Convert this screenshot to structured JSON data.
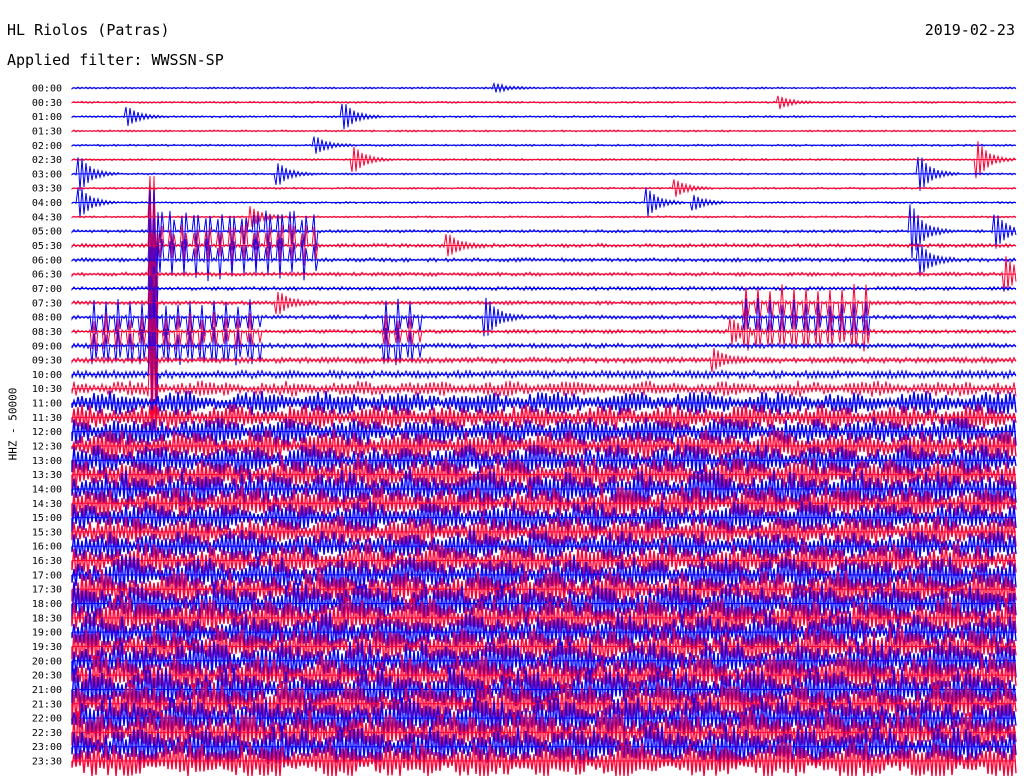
{
  "header": {
    "station": "HL Riolos (Patras)",
    "date": "2019-02-23",
    "filter": "Applied filter: WWSSN-SP"
  },
  "channel_label": "HHZ - 50000",
  "colors": {
    "trace_a": "#0000ff",
    "trace_b": "#ff0033",
    "baseline": "#0000ff"
  },
  "chart_data": {
    "type": "line",
    "title": "HL Riolos (Patras)",
    "subtitle": "Applied filter: WWSSN-SP",
    "ylabel": "HHZ - 50000",
    "xlabel": "",
    "row_labels": [
      "00:00",
      "00:30",
      "01:00",
      "01:30",
      "02:00",
      "02:30",
      "03:00",
      "03:30",
      "04:00",
      "04:30",
      "05:00",
      "05:30",
      "06:00",
      "06:30",
      "07:00",
      "07:30",
      "08:00",
      "08:30",
      "09:00",
      "09:30",
      "10:00",
      "10:30",
      "11:00",
      "11:30",
      "12:00",
      "12:30",
      "13:00",
      "13:30",
      "14:00",
      "14:30",
      "15:00",
      "15:30",
      "16:00",
      "16:30",
      "17:00",
      "17:30",
      "18:00",
      "18:30",
      "19:00",
      "19:30",
      "20:00",
      "20:30",
      "21:00",
      "21:30",
      "22:00",
      "22:30",
      "23:00",
      "23:30"
    ],
    "row_colors": [
      "blue",
      "red"
    ],
    "noise_level": [
      1,
      1,
      1,
      1,
      1,
      1,
      1,
      1,
      1,
      1,
      1.5,
      2,
      2,
      2,
      2,
      2,
      2,
      2,
      2.5,
      3,
      4,
      6,
      9,
      10,
      11,
      12,
      12,
      13,
      14,
      13,
      12,
      12,
      12,
      13,
      14,
      14,
      15,
      15,
      14,
      14,
      15,
      15,
      16,
      16,
      16,
      16,
      15,
      14
    ],
    "events": [
      {
        "row": 0,
        "pos": 0.45,
        "amp": 4
      },
      {
        "row": 1,
        "pos": 0.75,
        "amp": 6
      },
      {
        "row": 2,
        "pos": 0.06,
        "amp": 9
      },
      {
        "row": 2,
        "pos": 0.29,
        "amp": 12
      },
      {
        "row": 4,
        "pos": 0.26,
        "amp": 8
      },
      {
        "row": 5,
        "pos": 0.3,
        "amp": 12
      },
      {
        "row": 5,
        "pos": 0.96,
        "amp": 18
      },
      {
        "row": 6,
        "pos": 0.01,
        "amp": 16
      },
      {
        "row": 6,
        "pos": 0.22,
        "amp": 10
      },
      {
        "row": 6,
        "pos": 0.9,
        "amp": 16
      },
      {
        "row": 7,
        "pos": 0.64,
        "amp": 8
      },
      {
        "row": 8,
        "pos": 0.01,
        "amp": 14
      },
      {
        "row": 8,
        "pos": 0.61,
        "amp": 14
      },
      {
        "row": 8,
        "pos": 0.66,
        "amp": 7
      },
      {
        "row": 9,
        "pos": 0.19,
        "amp": 10
      },
      {
        "row": 10,
        "pos": 0.89,
        "amp": 26
      },
      {
        "row": 10,
        "pos": 0.98,
        "amp": 16
      },
      {
        "row": 11,
        "pos": 0.4,
        "amp": 10
      },
      {
        "row": 12,
        "pos": 0.9,
        "amp": 14
      },
      {
        "row": 13,
        "pos": 0.99,
        "amp": 16
      },
      {
        "row": 15,
        "pos": 0.22,
        "amp": 10
      },
      {
        "row": 16,
        "pos": 0.44,
        "amp": 18
      },
      {
        "row": 17,
        "pos": 0.7,
        "amp": 12
      },
      {
        "row": 19,
        "pos": 0.68,
        "amp": 10
      }
    ],
    "bursts": [
      {
        "row_start": 10,
        "row_end": 12,
        "from": 0.09,
        "to": 0.26,
        "amp": 20
      },
      {
        "row_start": 16,
        "row_end": 18,
        "from": 0.02,
        "to": 0.2,
        "amp": 18
      },
      {
        "row_start": 15,
        "row_end": 17,
        "from": 0.71,
        "to": 0.85,
        "amp": 18
      },
      {
        "row_start": 16,
        "row_end": 18,
        "from": 0.33,
        "to": 0.37,
        "amp": 18
      }
    ],
    "spike": {
      "row_start": 9,
      "row_end": 21,
      "pos": 0.085,
      "amp": 40
    }
  }
}
